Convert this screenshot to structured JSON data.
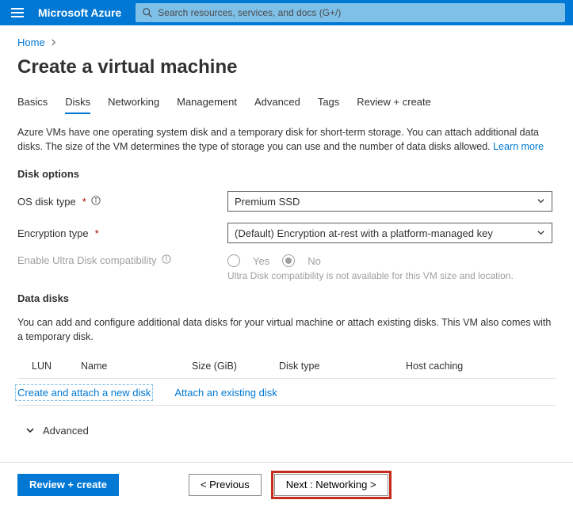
{
  "header": {
    "brand": "Microsoft Azure",
    "search_placeholder": "Search resources, services, and docs (G+/)"
  },
  "breadcrumb": {
    "home": "Home"
  },
  "page_title": "Create a virtual machine",
  "tabs": {
    "basics": "Basics",
    "disks": "Disks",
    "networking": "Networking",
    "management": "Management",
    "advanced": "Advanced",
    "tags": "Tags",
    "review": "Review + create"
  },
  "desc": {
    "text": "Azure VMs have one operating system disk and a temporary disk for short-term storage. You can attach additional data disks. The size of the VM determines the type of storage you can use and the number of data disks allowed.  ",
    "learn_more": "Learn more"
  },
  "disk_options": {
    "title": "Disk options",
    "os_disk_label": "OS disk type",
    "os_disk_value": "Premium SSD",
    "encryption_label": "Encryption type",
    "encryption_value": "(Default) Encryption at-rest with a platform-managed key",
    "ultra_label": "Enable Ultra Disk compatibility",
    "ultra_yes": "Yes",
    "ultra_no": "No",
    "ultra_hint": "Ultra Disk compatibility is not available for this VM size and location."
  },
  "data_disks": {
    "title": "Data disks",
    "desc": "You can add and configure additional data disks for your virtual machine or attach existing disks. This VM also comes with a temporary disk.",
    "cols": {
      "lun": "LUN",
      "name": "Name",
      "size": "Size (GiB)",
      "dtype": "Disk type",
      "cache": "Host caching"
    },
    "create_link": "Create and attach a new disk",
    "attach_link": "Attach an existing disk"
  },
  "advanced_toggle": "Advanced",
  "footer": {
    "review": "Review + create",
    "previous": "< Previous",
    "next": "Next : Networking >"
  }
}
